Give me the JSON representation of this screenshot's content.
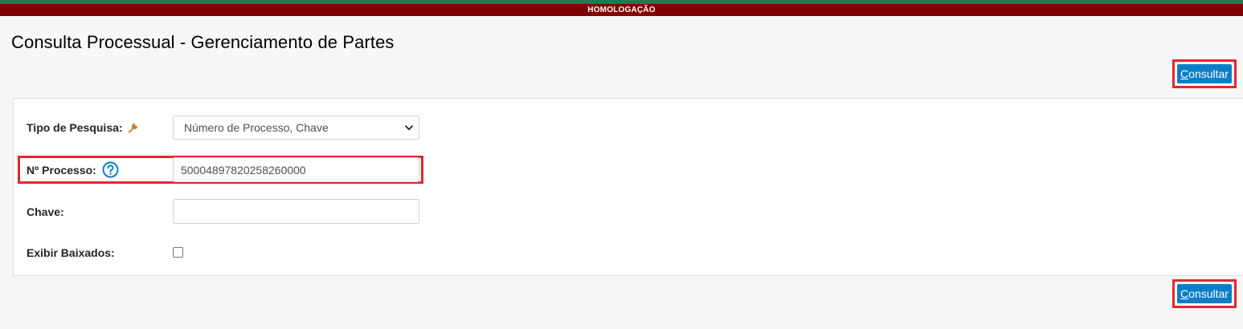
{
  "env_banner": "HOMOLOGAÇÃO",
  "page": {
    "title": "Consulta Processual - Gerenciamento de Partes"
  },
  "actions": {
    "consultar_top": {
      "accesskey": "C",
      "rest": "onsultar"
    },
    "consultar_bottom": {
      "accesskey": "C",
      "rest": "onsultar"
    }
  },
  "form": {
    "tipo_pesquisa": {
      "label": "Tipo de Pesquisa:",
      "selected": "Número de Processo, Chave"
    },
    "numero_processo": {
      "label": "Nº Processo:",
      "value": "50004897820258260000"
    },
    "chave": {
      "label": "Chave:",
      "value": ""
    },
    "exibir_baixados": {
      "label": "Exibir Baixados:",
      "checked": false
    }
  },
  "icons": {
    "tipo_pesquisa": "wrench-icon",
    "numero_processo": "help-circle-icon"
  },
  "colors": {
    "env_bar": "#7f0101",
    "top_stripe": "#1e7a4f",
    "button": "#0b7ec7",
    "highlight": "#e3262e",
    "help_icon": "#0b7ec7"
  }
}
